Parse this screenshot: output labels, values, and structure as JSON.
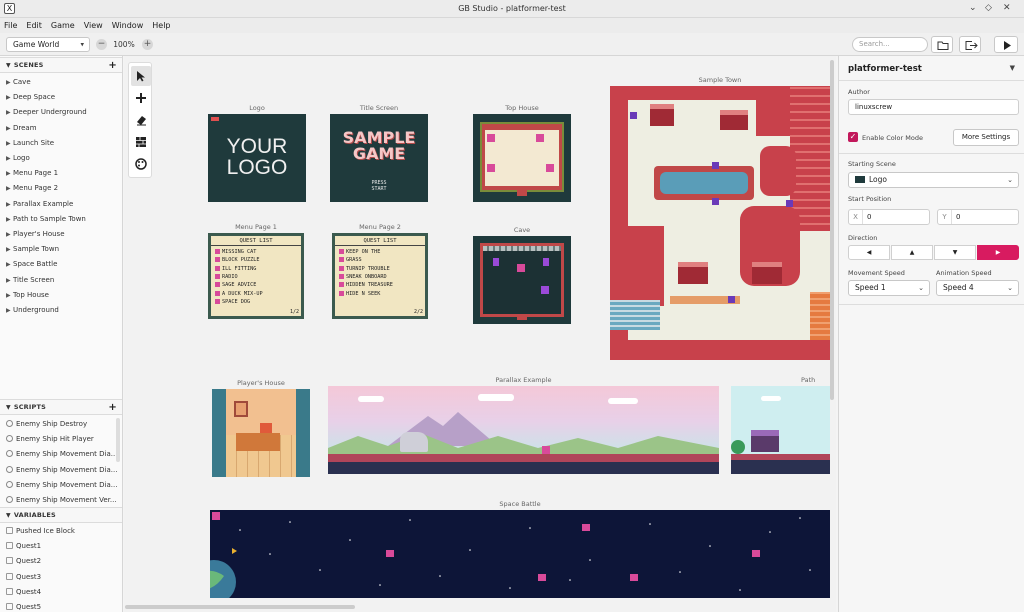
{
  "window": {
    "title": "GB Studio - platformer-test",
    "app_icon": "X"
  },
  "menu": [
    "File",
    "Edit",
    "Game",
    "View",
    "Window",
    "Help"
  ],
  "toolbar": {
    "view_select": "Game World",
    "zoom": "100%",
    "zoom_out_label": "−",
    "zoom_in_label": "+",
    "search_placeholder": "Search..."
  },
  "sidebar": {
    "scenes_header": "SCENES",
    "scenes": [
      "Cave",
      "Deep Space",
      "Deeper Underground",
      "Dream",
      "Launch Site",
      "Logo",
      "Menu Page 1",
      "Menu Page 2",
      "Parallax Example",
      "Path to Sample Town",
      "Player's House",
      "Sample Town",
      "Space Battle",
      "Title Screen",
      "Top House",
      "Underground"
    ],
    "scripts_header": "SCRIPTS",
    "scripts": [
      "Enemy Ship Destroy",
      "Enemy Ship Hit Player",
      "Enemy Ship Movement Dia...",
      "Enemy Ship Movement Dia...",
      "Enemy Ship Movement Dia...",
      "Enemy Ship Movement Ver..."
    ],
    "variables_header": "VARIABLES",
    "variables": [
      "Pushed Ice Block",
      "Quest1",
      "Quest2",
      "Quest3",
      "Quest4",
      "Quest5"
    ]
  },
  "scenes": {
    "logo": {
      "name": "Logo",
      "line1": "YOUR",
      "line2": "LOGO"
    },
    "title_screen": {
      "name": "Title Screen",
      "line1": "SAMPLE",
      "line2": "GAME",
      "press1": "PRESS",
      "press2": "START"
    },
    "top_house": {
      "name": "Top House"
    },
    "menu1": {
      "name": "Menu Page 1",
      "header": "QUEST LIST",
      "items": [
        "MISSING CAT",
        "BLOCK PUZZLE",
        "ILL FITTING",
        "RADIO",
        "SAGE ADVICE",
        "A DUCK MIX-UP",
        "SPACE DOG"
      ],
      "page": "1/2"
    },
    "menu2": {
      "name": "Menu Page 2",
      "header": "QUEST LIST",
      "items": [
        "KEEP ON THE",
        "GRASS",
        "TURNIP TROUBLE",
        "SNEAK ONBOARD",
        "HIDDEN TREASURE",
        "HIDE N SEEK"
      ],
      "page": "2/2"
    },
    "cave": {
      "name": "Cave"
    },
    "sample_town": {
      "name": "Sample Town"
    },
    "players_house": {
      "name": "Player's House"
    },
    "parallax": {
      "name": "Parallax Example"
    },
    "path": {
      "name": "Path"
    },
    "space_battle": {
      "name": "Space Battle"
    }
  },
  "panel": {
    "title": "platformer-test",
    "menu_icon": "▼",
    "author_label": "Author",
    "author_value": "linuxscrew",
    "color_mode_label": "Enable Color Mode",
    "more_settings": "More Settings",
    "starting_scene_label": "Starting Scene",
    "starting_scene_value": "Logo",
    "start_position_label": "Start Position",
    "x_label": "X",
    "x_value": "0",
    "y_label": "Y",
    "y_value": "0",
    "direction_label": "Direction",
    "directions": [
      "◀",
      "▲",
      "▼",
      "▶"
    ],
    "direction_selected": "right",
    "movement_speed_label": "Movement Speed",
    "movement_speed_value": "Speed 1",
    "animation_speed_label": "Animation Speed",
    "animation_speed_value": "Speed 4"
  },
  "colors": {
    "accent": "#d81b60",
    "town_red": "#c8414b",
    "space_bg": "#0d1538",
    "gb_dark": "#1f3a3c",
    "cream": "#f3e9d2"
  }
}
